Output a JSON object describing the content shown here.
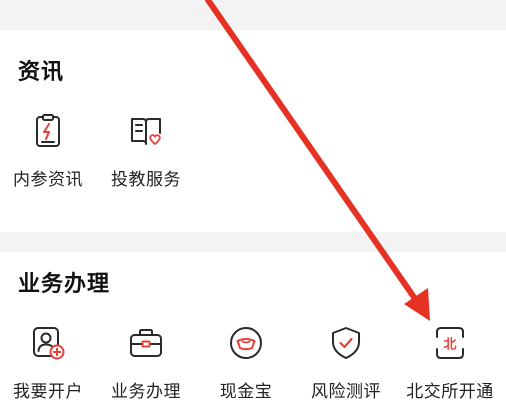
{
  "sections": {
    "news": {
      "title": "资讯",
      "items": [
        {
          "label": "内参资讯",
          "icon": "document-lightning-icon"
        },
        {
          "label": "投教服务",
          "icon": "book-heart-icon"
        }
      ]
    },
    "business": {
      "title": "业务办理",
      "items": [
        {
          "label": "我要开户",
          "icon": "person-plus-icon"
        },
        {
          "label": "业务办理",
          "icon": "briefcase-icon"
        },
        {
          "label": "现金宝",
          "icon": "coin-ingot-icon"
        },
        {
          "label": "风险测评",
          "icon": "shield-check-icon"
        },
        {
          "label": "北交所开通",
          "icon": "bse-badge-icon",
          "badge": "北"
        }
      ]
    }
  },
  "colors": {
    "icon_stroke": "#2a2a2a",
    "accent": "#e8413a",
    "annotation_arrow": "#e53224",
    "band": "#f3f3f3"
  }
}
